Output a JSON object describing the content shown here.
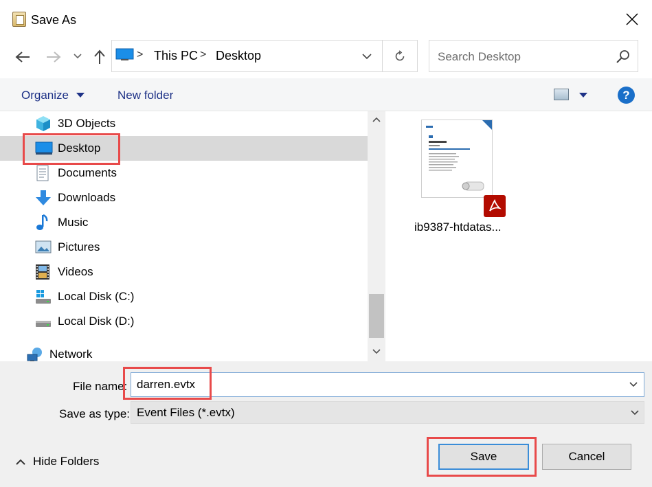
{
  "window": {
    "title": "Save As"
  },
  "nav": {
    "breadcrumb": [
      "This PC",
      "Desktop"
    ],
    "separator": ">"
  },
  "search": {
    "placeholder": "Search Desktop",
    "value": ""
  },
  "toolbar": {
    "organize_label": "Organize",
    "new_folder_label": "New folder",
    "help_label": "?"
  },
  "sidebar": {
    "items": [
      {
        "label": "3D Objects",
        "icon": "cube-3d-icon"
      },
      {
        "label": "Desktop",
        "icon": "desktop-icon",
        "selected": true
      },
      {
        "label": "Documents",
        "icon": "documents-icon"
      },
      {
        "label": "Downloads",
        "icon": "download-arrow-icon"
      },
      {
        "label": "Music",
        "icon": "music-note-icon"
      },
      {
        "label": "Pictures",
        "icon": "pictures-icon"
      },
      {
        "label": "Videos",
        "icon": "film-icon"
      },
      {
        "label": "Local Disk (C:)",
        "icon": "windows-drive-icon"
      },
      {
        "label": "Local Disk (D:)",
        "icon": "drive-icon"
      },
      {
        "label": "Network",
        "icon": "network-icon"
      }
    ]
  },
  "content": {
    "files": [
      {
        "name": "ib9387-htdatas...",
        "type": "pdf"
      }
    ]
  },
  "form": {
    "file_name_label": "File name:",
    "file_name_value": "darren.evtx",
    "save_type_label": "Save as type:",
    "save_type_value": "Event Files (*.evtx)"
  },
  "footer": {
    "hide_folders_label": "Hide Folders",
    "save_label": "Save",
    "cancel_label": "Cancel"
  },
  "colors": {
    "accent": "#1a6fc9",
    "link": "#1e3287",
    "selection": "#d9d9d9",
    "annotation": "#e84a4a",
    "pdf_badge": "#b30b00"
  }
}
